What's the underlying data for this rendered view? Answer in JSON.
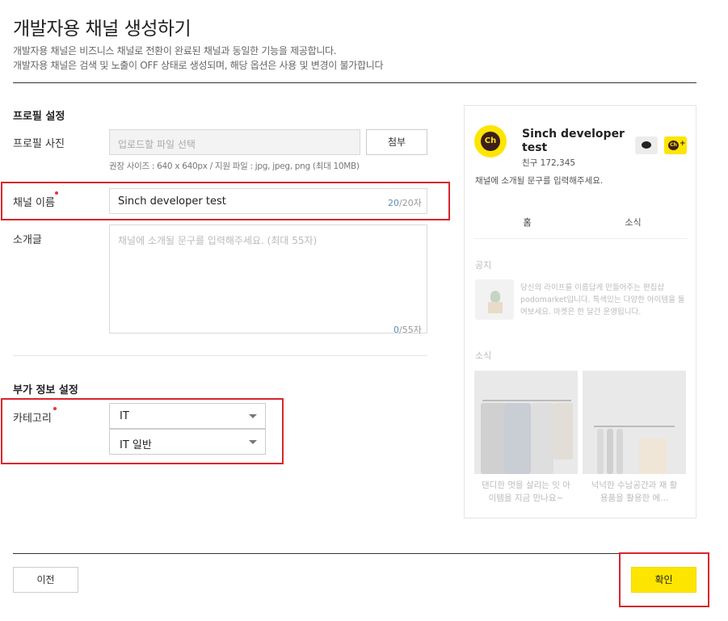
{
  "page": {
    "title": "개발자용 채널 생성하기",
    "description_1": "개발자용 채널은 비즈니스 채널로 전환이 완료된 채널과 동일한 기능을 제공합니다.",
    "description_2": "개발자용 채널은 검색 및 노출이 OFF 상태로 생성되며, 해당 옵션은 사용 및 변경이 불가합니다"
  },
  "profile": {
    "section_title": "프로필 설정",
    "photo_label": "프로필 사진",
    "photo_placeholder": "업로드할 파일 선택",
    "attach_label": "첨부",
    "photo_hint": "권장 사이즈 : 640 x 640px / 지원 파일 : jpg, jpeg, png (최대 10MB)",
    "name_label": "채널 이름",
    "name_value": "Sinch developer test",
    "name_count": "20",
    "name_limit": "/20자",
    "intro_label": "소개글",
    "intro_placeholder": "채널에 소개될 문구를 입력해주세요. (최대 55자)",
    "intro_count": "0",
    "intro_limit": "/55자"
  },
  "extra": {
    "section_title": "부가 정보 설정",
    "category_label": "카테고리",
    "category_primary": "IT",
    "category_secondary": "IT 일반"
  },
  "preview": {
    "logo_text": "Ch",
    "channel_name": "Sinch developer test",
    "friends": "친구 172,345",
    "intro": "채널에 소개될 문구를 입력해주세요.",
    "tab_home": "홈",
    "tab_news": "소식",
    "notice_title": "공지",
    "notice_text": "당신의 라이프를 이름답게 만들어주는 편집샵 podomarket입니다. 특색있는 다양한 아이템을 둘여보세요. 마켓은 한 달간 운영됩니다.",
    "news_title": "소식",
    "cards": [
      {
        "caption": "댄디한 멋을 살리는 잇 아이템을 지금 만나요~"
      },
      {
        "caption": "넉넉한 수납공간과 재 활용품을 활용한 에..."
      }
    ]
  },
  "footer": {
    "prev_label": "이전",
    "confirm_label": "확인"
  },
  "colors": {
    "accent_yellow": "#fee500",
    "highlight_red": "#d9262c",
    "required_dot": "#e9343a"
  }
}
